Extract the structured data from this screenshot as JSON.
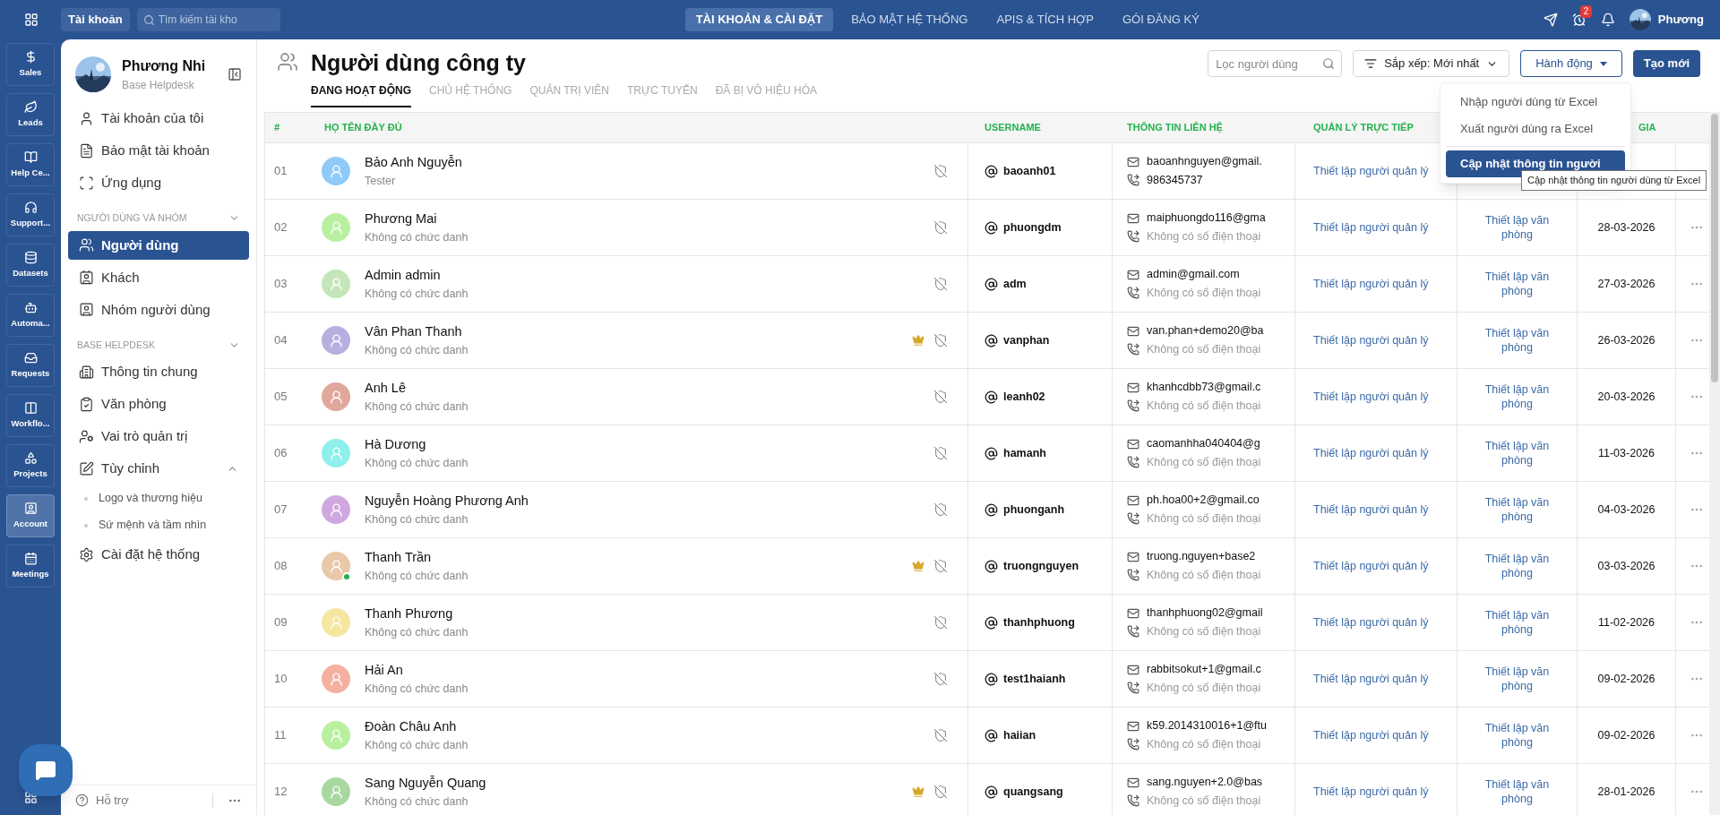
{
  "topbar": {
    "account_button": "Tài khoản",
    "search": {
      "placeholder": "Tìm kiếm tài kho"
    },
    "tabs": [
      {
        "label": "TÀI KHOẢN & CÀI ĐẶT",
        "selected": true
      },
      {
        "label": "BẢO MẬT HỆ THỐNG",
        "selected": false
      },
      {
        "label": "APIS & TÍCH HỢP",
        "selected": false
      },
      {
        "label": "GÓI ĐĂNG KÝ",
        "selected": false
      }
    ],
    "alarm_badge": "2",
    "user_name": "Phương"
  },
  "rail": [
    {
      "label": "Sales",
      "selected": false
    },
    {
      "label": "Leads",
      "selected": false
    },
    {
      "label": "Help Ce...",
      "selected": false
    },
    {
      "label": "Support...",
      "selected": false
    },
    {
      "label": "Datasets",
      "selected": false
    },
    {
      "label": "Automa...",
      "selected": false
    },
    {
      "label": "Requests",
      "selected": false
    },
    {
      "label": "Workflo...",
      "selected": false
    },
    {
      "label": "Projects",
      "selected": false
    },
    {
      "label": "Account",
      "selected": true
    },
    {
      "label": "Meetings",
      "selected": false
    }
  ],
  "sidebar": {
    "profile": {
      "name": "Phương Nhi",
      "subtitle": "Base Helpdesk"
    },
    "top_items": [
      {
        "label": "Tài khoản của tôi",
        "selected": false
      },
      {
        "label": "Bảo mật tài khoản",
        "selected": false
      },
      {
        "label": "Ứng dụng",
        "selected": false
      }
    ],
    "sections": [
      {
        "title": "NGƯỜI DÙNG VÀ NHÓM",
        "expanded": true,
        "items": [
          {
            "label": "Người dùng",
            "selected": true
          },
          {
            "label": "Khách",
            "selected": false
          },
          {
            "label": "Nhóm người dùng",
            "selected": false
          }
        ]
      },
      {
        "title": "BASE HELPDESK",
        "expanded": true,
        "items": [
          {
            "label": "Thông tin chung",
            "selected": false
          },
          {
            "label": "Văn phòng",
            "selected": false
          },
          {
            "label": "Vai trò quản trị",
            "selected": false
          },
          {
            "label": "Tùy chỉnh",
            "selected": false,
            "expanded": true,
            "children": [
              {
                "label": "Logo và thương hiệu",
                "selected": false
              },
              {
                "label": "Sứ mệnh và tầm nhìn",
                "selected": false
              }
            ]
          },
          {
            "label": "Cài đặt hệ thống",
            "selected": false
          }
        ]
      }
    ],
    "footer": "Hỗ trợ"
  },
  "main": {
    "title": "Người dùng công ty",
    "tabs": [
      {
        "label": "ĐANG HOẠT ĐỘNG",
        "selected": true
      },
      {
        "label": "CHỦ HỆ THỐNG",
        "selected": false
      },
      {
        "label": "QUẢN TRỊ VIÊN",
        "selected": false
      },
      {
        "label": "TRỰC TUYẾN",
        "selected": false
      },
      {
        "label": "ĐÃ BỊ VÔ HIỆU HÓA",
        "selected": false
      }
    ],
    "filter": {
      "placeholder": "Lọc người dùng"
    },
    "sort_button": "Sắp xếp: Mới nhất",
    "action_button": "Hành động",
    "create_button": "Tạo mới",
    "action_menu": {
      "items": [
        {
          "label": "Nhập người dùng từ Excel",
          "selected": false
        },
        {
          "label": "Xuất người dùng ra Excel",
          "selected": false
        },
        {
          "label": "Cập nhật thông tin người",
          "selected": true
        }
      ],
      "tooltip": "Cập nhật thông tin người dùng từ Excel"
    }
  },
  "table": {
    "columns": [
      "#",
      "HỌ TÊN ĐẦY ĐỦ",
      "USERNAME",
      "THÔNG TIN LIÊN HỆ",
      "QUẢN LÝ TRỰC TIẾP",
      "GIA"
    ],
    "rows": [
      {
        "index": "01",
        "name": "Bảo Anh Nguyễn",
        "title": "Tester",
        "color": "#90caf9",
        "online": false,
        "crown": false,
        "username": "baoanh01",
        "email": "baoanhnguyen@gmail.",
        "phone": "986345737",
        "phone_muted": false,
        "manager": "Thiết lập người quản lý"
      },
      {
        "index": "02",
        "name": "Phương Mai",
        "title": "Không có chức danh",
        "color": "#b9f0a0",
        "online": false,
        "crown": false,
        "username": "phuongdm",
        "email": "maiphuongdo116@gma",
        "phone": "Không có số điện thoại",
        "phone_muted": true,
        "manager": "Thiết lập người quản lý",
        "office": "Thiết lập văn phòng",
        "date": "28-03-2026"
      },
      {
        "index": "03",
        "name": "Admin admin",
        "title": "Không có chức danh",
        "color": "#c5e6b8",
        "online": false,
        "crown": false,
        "username": "adm",
        "email": "admin@gmail.com",
        "phone": "Không có số điện thoại",
        "phone_muted": true,
        "manager": "Thiết lập người quản lý",
        "office": "Thiết lập văn phòng",
        "date": "27-03-2026"
      },
      {
        "index": "04",
        "name": "Vân Phan Thanh",
        "title": "Không có chức danh",
        "color": "#b9aee0",
        "online": false,
        "crown": true,
        "username": "vanphan",
        "email": "van.phan+demo20@ba",
        "phone": "Không có số điện thoại",
        "phone_muted": true,
        "manager": "Thiết lập người quản lý",
        "office": "Thiết lập văn phòng",
        "date": "26-03-2026"
      },
      {
        "index": "05",
        "name": "Anh Lê",
        "title": "Không có chức danh",
        "color": "#e0a89c",
        "online": false,
        "crown": false,
        "username": "leanh02",
        "email": "khanhcdbb73@gmail.c",
        "phone": "Không có số điện thoại",
        "phone_muted": true,
        "manager": "Thiết lập người quản lý",
        "office": "Thiết lập văn phòng",
        "date": "20-03-2026"
      },
      {
        "index": "06",
        "name": "Hà Dương",
        "title": "Không có chức danh",
        "color": "#8ef0ec",
        "online": false,
        "crown": false,
        "username": "hamanh",
        "email": "caomanhha040404@g",
        "phone": "Không có số điện thoại",
        "phone_muted": true,
        "manager": "Thiết lập người quản lý",
        "office": "Thiết lập văn phòng",
        "date": "11-03-2026"
      },
      {
        "index": "07",
        "name": "Nguyễn Hoàng Phương Anh",
        "title": "Không có chức danh",
        "color": "#d0a8e0",
        "online": false,
        "crown": false,
        "username": "phuonganh",
        "email": "ph.hoa00+2@gmail.co",
        "phone": "Không có số điện thoại",
        "phone_muted": true,
        "manager": "Thiết lập người quản lý",
        "office": "Thiết lập văn phòng",
        "date": "04-03-2026"
      },
      {
        "index": "08",
        "name": "Thanh Trần",
        "title": "Không có chức danh",
        "color": "#e8c8a8",
        "online": true,
        "crown": true,
        "username": "truongnguyen",
        "email": "truong.nguyen+base2",
        "phone": "Không có số điện thoại",
        "phone_muted": true,
        "manager": "Thiết lập người quản lý",
        "office": "Thiết lập văn phòng",
        "date": "03-03-2026"
      },
      {
        "index": "09",
        "name": "Thanh Phương",
        "title": "Không có chức danh",
        "color": "#f5e6a0",
        "online": false,
        "crown": false,
        "username": "thanhphuong",
        "email": "thanhphuong02@gmail",
        "phone": "Không có số điện thoại",
        "phone_muted": true,
        "manager": "Thiết lập người quản lý",
        "office": "Thiết lập văn phòng",
        "date": "11-02-2026"
      },
      {
        "index": "10",
        "name": "Hải An",
        "title": "Không có chức danh",
        "color": "#f5b0a0",
        "online": false,
        "crown": false,
        "username": "test1haianh",
        "email": "rabbitsokut+1@gmail.c",
        "phone": "Không có số điện thoại",
        "phone_muted": true,
        "manager": "Thiết lập người quản lý",
        "office": "Thiết lập văn phòng",
        "date": "09-02-2026"
      },
      {
        "index": "11",
        "name": "Đoàn Châu Anh",
        "title": "Không có chức danh",
        "color": "#b9f0a0",
        "online": false,
        "crown": false,
        "username": "haiian",
        "email": "k59.2014310016+1@ftu",
        "phone": "Không có số điện thoại",
        "phone_muted": true,
        "manager": "Thiết lập người quản lý",
        "office": "Thiết lập văn phòng",
        "date": "09-02-2026"
      },
      {
        "index": "12",
        "name": "Sang Nguyễn Quang",
        "title": "Không có chức danh",
        "color": "#a8d8a0",
        "online": false,
        "crown": true,
        "username": "quangsang",
        "email": "sang.nguyen+2.0@bas",
        "phone": "Không có số điện thoại",
        "phone_muted": true,
        "manager": "Thiết lập người quản lý",
        "office": "Thiết lập văn phòng",
        "date": "28-01-2026"
      }
    ]
  }
}
